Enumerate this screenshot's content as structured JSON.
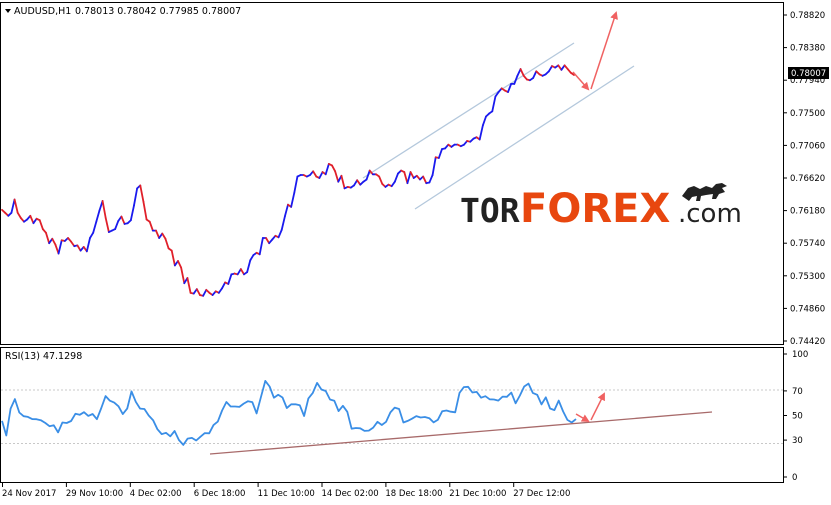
{
  "colors": {
    "bull": "#1a1aee",
    "bear": "#e0202a",
    "rsi": "#3a8ee6",
    "channel": "#b4c8dc",
    "arrow": "#f06262",
    "trendline": "#a86a6a",
    "grid": "#c8c8c8",
    "frame": "#000000"
  },
  "price_header": {
    "symbol": "AUDUSD,H1",
    "values": "0.78013 0.78042 0.77985 0.78007"
  },
  "rsi_header": {
    "label": "RSI(13) 47.1298"
  },
  "price_tag": "0.78007",
  "logo": {
    "tor": "TOR",
    "forex": "FOREX",
    "dotcom": ".com",
    "icon": "bull-icon"
  },
  "chart_data": [
    {
      "type": "line",
      "name": "AUDUSD H1 price",
      "x_labels": [
        "24 Nov 2017",
        "29 Nov 10:00",
        "4 Dec 02:00",
        "6 Dec 18:00",
        "11 Dec 10:00",
        "14 Dec 02:00",
        "18 Dec 18:00",
        "21 Dec 10:00",
        "27 Dec 12:00"
      ],
      "y_ticks": [
        "0.78820",
        "0.78380",
        "0.77940",
        "0.77500",
        "0.77060",
        "0.76620",
        "0.76180",
        "0.75740",
        "0.75300",
        "0.74860",
        "0.74420"
      ],
      "ylim": [
        0.7442,
        0.7904
      ],
      "last_price": 0.78007,
      "series": [
        {
          "values": [
            0.7619,
            0.7615,
            0.7611,
            0.7615,
            0.7633,
            0.7615,
            0.7608,
            0.7603,
            0.7606,
            0.7611,
            0.7601,
            0.7607,
            0.7605,
            0.7593,
            0.7588,
            0.7574,
            0.758,
            0.7572,
            0.756,
            0.7578,
            0.7577,
            0.7581,
            0.7576,
            0.757,
            0.7571,
            0.7564,
            0.7569,
            0.7563,
            0.7581,
            0.7588,
            0.7603,
            0.7618,
            0.7631,
            0.7608,
            0.7589,
            0.7591,
            0.7593,
            0.7604,
            0.761,
            0.76,
            0.7601,
            0.7605,
            0.7625,
            0.7648,
            0.7652,
            0.763,
            0.7606,
            0.7603,
            0.7591,
            0.7591,
            0.7581,
            0.7587,
            0.758,
            0.7567,
            0.7564,
            0.7544,
            0.755,
            0.7541,
            0.752,
            0.7527,
            0.7507,
            0.7506,
            0.7512,
            0.7504,
            0.7503,
            0.7511,
            0.7507,
            0.7504,
            0.7509,
            0.7507,
            0.7513,
            0.7521,
            0.7519,
            0.7532,
            0.7533,
            0.7532,
            0.7539,
            0.7532,
            0.7535,
            0.7551,
            0.7558,
            0.7561,
            0.7559,
            0.7581,
            0.7581,
            0.7574,
            0.7579,
            0.7584,
            0.7582,
            0.7592,
            0.761,
            0.7626,
            0.7623,
            0.7642,
            0.7664,
            0.7666,
            0.7666,
            0.7664,
            0.7666,
            0.7671,
            0.7664,
            0.7662,
            0.767,
            0.7667,
            0.7681,
            0.7679,
            0.7671,
            0.7657,
            0.7665,
            0.7648,
            0.765,
            0.7649,
            0.7652,
            0.7659,
            0.7653,
            0.7657,
            0.766,
            0.7672,
            0.7667,
            0.7667,
            0.7664,
            0.7654,
            0.765,
            0.7653,
            0.7651,
            0.7657,
            0.7668,
            0.7672,
            0.767,
            0.7655,
            0.767,
            0.7662,
            0.7665,
            0.766,
            0.7664,
            0.7655,
            0.7656,
            0.7666,
            0.769,
            0.7689,
            0.7701,
            0.7702,
            0.7707,
            0.7704,
            0.7707,
            0.7707,
            0.7705,
            0.7707,
            0.7712,
            0.7711,
            0.7715,
            0.7717,
            0.7714,
            0.7733,
            0.7745,
            0.7749,
            0.7752,
            0.7772,
            0.7778,
            0.7783,
            0.778,
            0.7778,
            0.7789,
            0.7789,
            0.78,
            0.7809,
            0.78,
            0.7795,
            0.7794,
            0.7797,
            0.7806,
            0.7802,
            0.78,
            0.7802,
            0.7806,
            0.7813,
            0.7811,
            0.7814,
            0.7808,
            0.7814,
            0.7809,
            0.7804,
            0.7801
          ]
        }
      ]
    },
    {
      "type": "line",
      "name": "RSI(13)",
      "y_ticks": [
        "100",
        "70",
        "50",
        "30",
        "0"
      ],
      "ylim": [
        0,
        100
      ],
      "last_value": 47.1298,
      "series": [
        {
          "values": [
            45.6,
            33.7,
            55.6,
            63.3,
            52.4,
            49.4,
            48.9,
            47.1,
            47.0,
            46.2,
            44.0,
            41.3,
            42.0,
            36.3,
            44.3,
            43.9,
            45.5,
            51.4,
            50.6,
            52.7,
            49.7,
            51.2,
            47.0,
            56.1,
            65.8,
            62.0,
            60.5,
            57.5,
            51.1,
            55.6,
            69.6,
            61.1,
            55.6,
            55.3,
            50.0,
            46.2,
            38.9,
            34.9,
            35.9,
            33.1,
            37.4,
            30.1,
            26.1,
            31.2,
            31.8,
            29.7,
            32.8,
            35.7,
            35.5,
            42.2,
            45.0,
            54.1,
            61.0,
            57.3,
            57.3,
            57.0,
            59.7,
            61.6,
            60.9,
            51.7,
            64.9,
            78.1,
            73.6,
            64.5,
            66.8,
            64.6,
            56.1,
            59.1,
            59.1,
            58.3,
            49.6,
            63.9,
            68.2,
            76.5,
            71.1,
            69.9,
            63.0,
            62.0,
            53.6,
            57.9,
            53.0,
            39.3,
            39.8,
            39.6,
            37.5,
            37.7,
            40.2,
            44.9,
            42.3,
            44.9,
            52.5,
            56.4,
            55.3,
            44.3,
            45.6,
            47.4,
            49.5,
            48.4,
            48.8,
            47.8,
            44.4,
            46.6,
            53.4,
            54.1,
            53.1,
            52.6,
            68.4,
            73.1,
            73.3,
            68.7,
            69.2,
            64.5,
            65.7,
            63.2,
            63.0,
            62.1,
            65.4,
            65.2,
            68.6,
            59.9,
            66.3,
            73.6,
            75.9,
            68.4,
            66.8,
            59.0,
            64.8,
            55.7,
            54.4,
            62.1,
            53.3,
            46.4,
            44.3,
            47.1
          ]
        }
      ]
    }
  ]
}
